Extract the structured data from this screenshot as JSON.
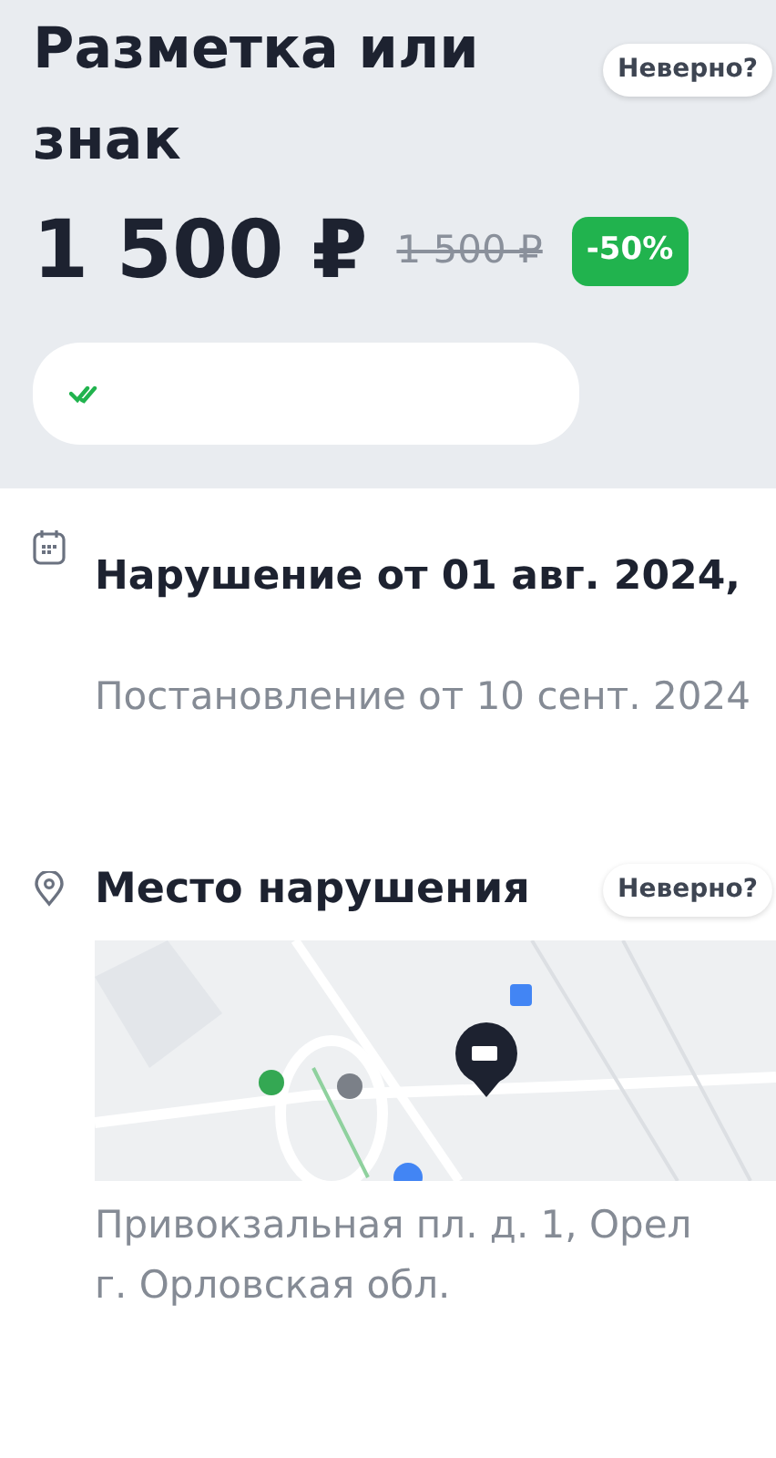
{
  "header": {
    "title": "Разметка или знак",
    "wrong_button": "Неверно?",
    "price": "1 500 ₽",
    "old_price": "1 500 ₽",
    "discount": "-50%"
  },
  "status_pill": {
    "kind": "paid"
  },
  "violation": {
    "date": "Нарушение от 01 авг. 2024,",
    "decision": "Постановление от 10 сент. 2024"
  },
  "place": {
    "title": "Место нарушения",
    "wrong_button": "Неверно?",
    "address": "Привокзальная пл. д. 1, Орел г. Орловская обл."
  }
}
